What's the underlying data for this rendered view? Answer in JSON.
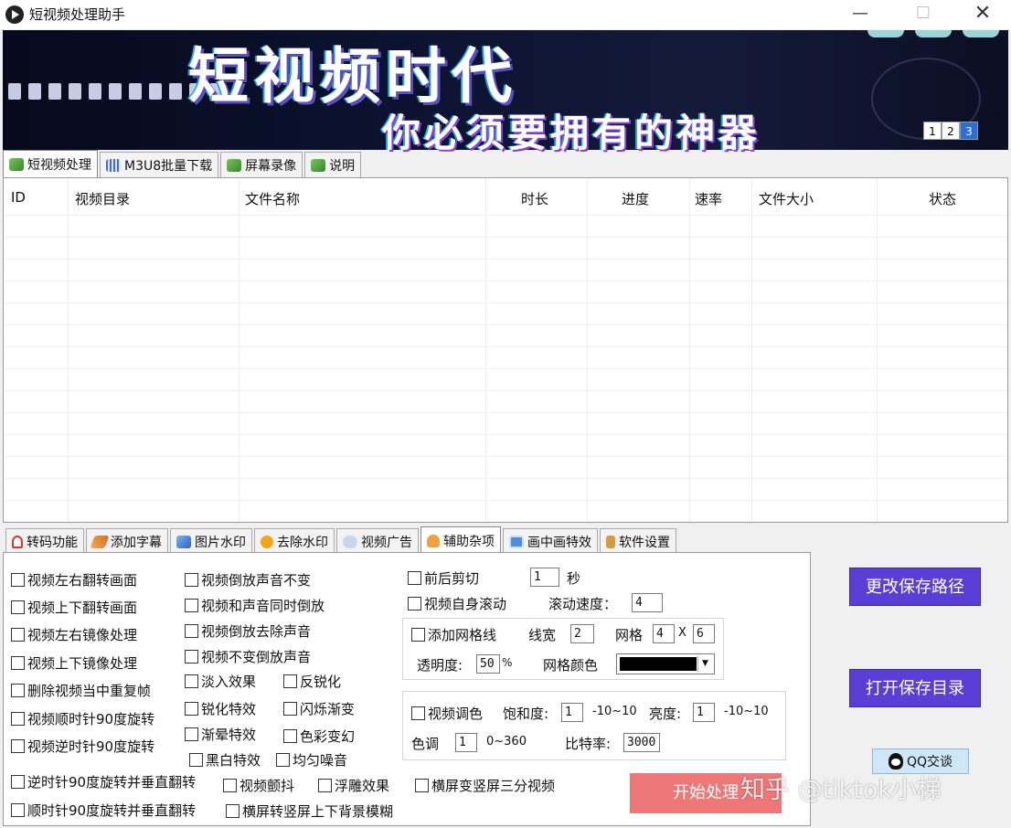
{
  "window": {
    "title": "短视频处理助手",
    "minimize": "—",
    "maximize": "☐",
    "close": "✕"
  },
  "banner": {
    "headline": "短视频时代",
    "subline": "你必须要拥有的神器",
    "pages": [
      "1",
      "2",
      "3"
    ]
  },
  "main_tabs": [
    {
      "label": "短视频处理",
      "icon": "green-film-icon"
    },
    {
      "label": "M3U8批量下载",
      "icon": "grid-icon"
    },
    {
      "label": "屏幕录像",
      "icon": "green-film-icon"
    },
    {
      "label": "说明",
      "icon": "green-film-icon"
    }
  ],
  "table": {
    "columns": [
      "ID",
      "视频目录",
      "文件名称",
      "时长",
      "进度",
      "速率",
      "文件大小",
      "状态"
    ]
  },
  "sub_tabs": [
    {
      "label": "转码功能",
      "icon": "transcode-icon"
    },
    {
      "label": "添加字幕",
      "icon": "pen-icon"
    },
    {
      "label": "图片水印",
      "icon": "folder-icon"
    },
    {
      "label": "去除水印",
      "icon": "circle-icon"
    },
    {
      "label": "视频广告",
      "icon": "cloud-icon"
    },
    {
      "label": "辅助杂项",
      "icon": "person-icon"
    },
    {
      "label": "画中画特效",
      "icon": "pip-icon"
    },
    {
      "label": "软件设置",
      "icon": "settings-icon"
    }
  ],
  "options": {
    "col1": [
      "视频左右翻转画面",
      "视频上下翻转画面",
      "视频左右镜像处理",
      "视频上下镜像处理",
      "删除视频当中重复帧",
      "视频顺时针90度旋转",
      "视频逆时针90度旋转"
    ],
    "col2": [
      "视频倒放声音不变",
      "视频和声音同时倒放",
      "视频倒放去除声音",
      "视频不变倒放声音"
    ],
    "col2_pairs": [
      [
        "淡入效果",
        "反锐化"
      ],
      [
        "锐化特效",
        "闪烁渐变"
      ],
      [
        "渐晕特效",
        "色彩变幻"
      ],
      [
        "黑白特效",
        "均匀噪音"
      ]
    ],
    "row_bottom1": [
      "逆时针90度旋转并垂直翻转",
      "视频颤抖",
      "浮雕效果",
      "横屏变竖屏三分视频"
    ],
    "row_bottom2": [
      "顺时针90度旋转并垂直翻转",
      "横屏转竖屏上下背景模糊"
    ]
  },
  "trim": {
    "label": "前后剪切",
    "value": "1",
    "unit": "秒"
  },
  "scroll": {
    "label": "视频自身滚动",
    "speed_label": "滚动速度：",
    "speed": "4"
  },
  "gridlines": {
    "label": "添加网格线",
    "width_label": "线宽",
    "width": "2",
    "grid_label": "网格",
    "rows": "4",
    "x": "X",
    "cols": "6",
    "opacity_label": "透明度:",
    "opacity": "50",
    "percent": "%",
    "color_label": "网格颜色",
    "color": "#000000"
  },
  "color_adjust": {
    "label": "视频调色",
    "sat_label": "饱和度:",
    "sat": "1",
    "sat_range": "-10~10",
    "bright_label": "亮度:",
    "bright": "1",
    "bright_range": "-10~10",
    "hue_label": "色调",
    "hue": "1",
    "hue_range": "0~360",
    "bitrate_label": "比特率:",
    "bitrate": "3000"
  },
  "buttons": {
    "change_path": "更改保存路径",
    "open_dir": "打开保存目录",
    "qq": "QQ交谈",
    "start": "开始处理"
  },
  "watermark": "知乎 @tiktok小梯"
}
